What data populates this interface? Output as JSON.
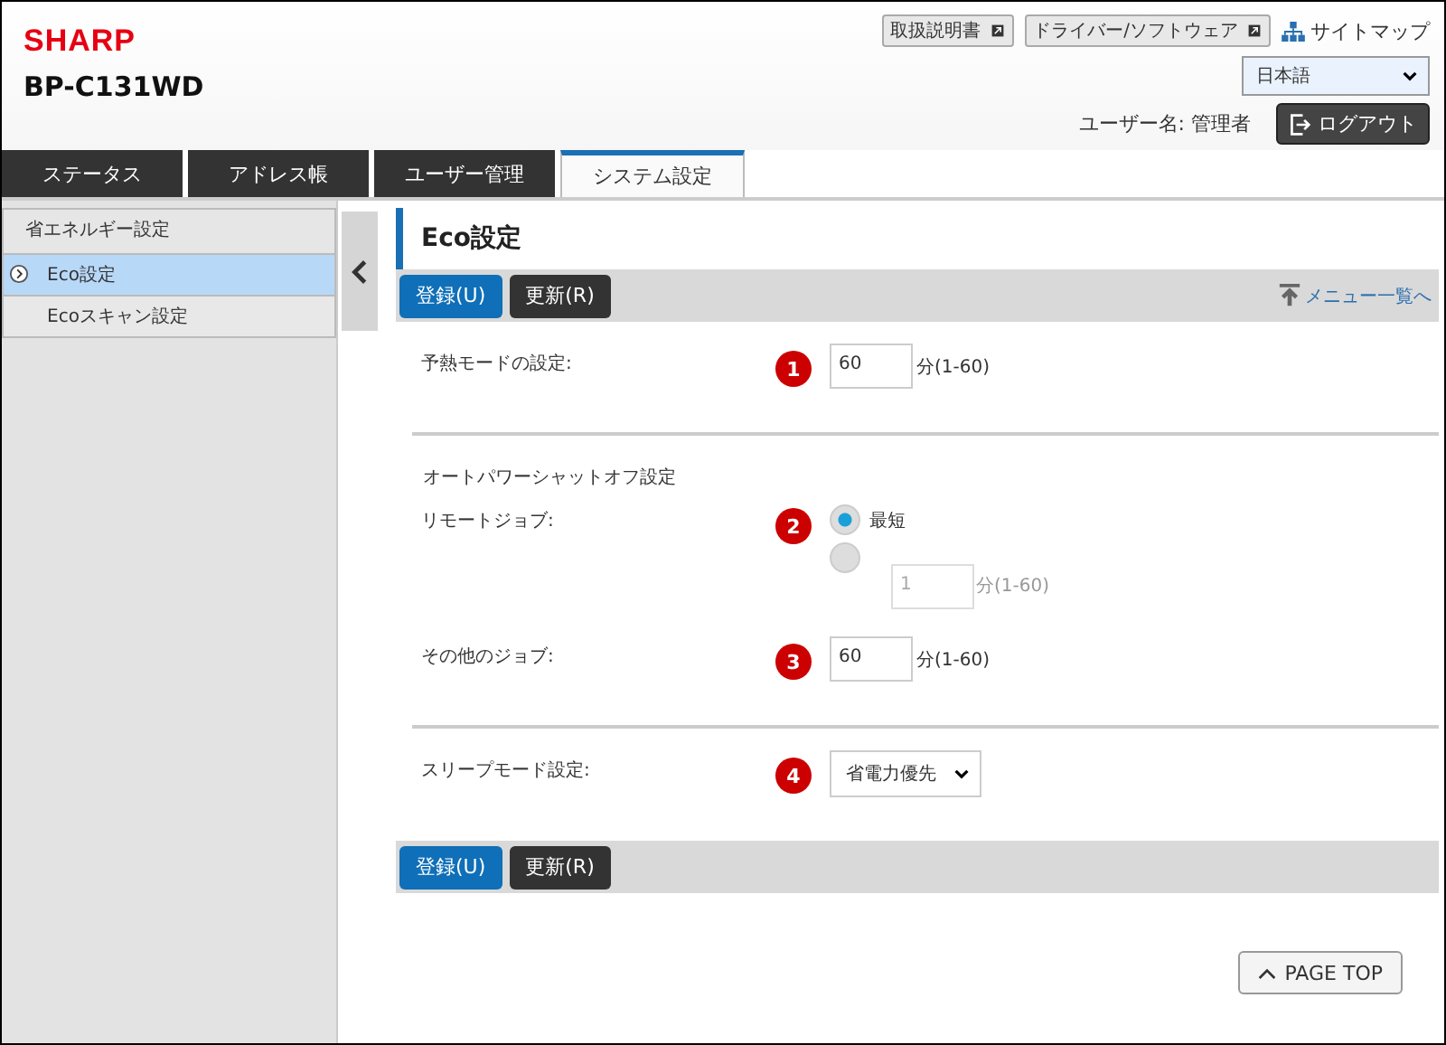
{
  "header": {
    "logo": "SHARP",
    "model": "BP-C131WD",
    "links": [
      {
        "label": "取扱説明書"
      },
      {
        "label": "ドライバー/ソフトウェア"
      }
    ],
    "sitemap": "サイトマップ",
    "language": "日本語",
    "user": "ユーザー名: 管理者",
    "logout": "ログアウト"
  },
  "tabs": [
    {
      "label": "ステータス",
      "selected": false
    },
    {
      "label": "アドレス帳",
      "selected": false
    },
    {
      "label": "ユーザー管理",
      "selected": false
    },
    {
      "label": "システム設定",
      "selected": true
    }
  ],
  "sidebar": {
    "title": "省エネルギー設定",
    "items": [
      {
        "label": "Eco設定",
        "selected": true
      },
      {
        "label": "Ecoスキャン設定",
        "selected": false
      }
    ]
  },
  "page": {
    "title": "Eco設定",
    "buttons": [
      {
        "label": "登録(U)",
        "kind": "primary"
      },
      {
        "label": "更新(R)",
        "kind": "dark"
      }
    ],
    "menu_link": "メニュー一覧へ",
    "sections": [
      {
        "rows": [
          {
            "label": "予熱モードの設定:",
            "badge": "1",
            "kind": "number",
            "value": "60",
            "unit": "分(1-60)"
          }
        ]
      },
      {
        "heading": "オートパワーシャットオフ設定",
        "rows": [
          {
            "label": "リモートジョブ:",
            "badge": "2",
            "kind": "radio",
            "options": [
              {
                "label": "最短",
                "selected": true
              },
              {
                "value": "1",
                "unit": "分(1-60)",
                "selected": false,
                "disabled": true
              }
            ]
          },
          {
            "label": "その他のジョブ:",
            "badge": "3",
            "kind": "number",
            "value": "60",
            "unit": "分(1-60)"
          }
        ]
      },
      {
        "rows": [
          {
            "label": "スリープモード設定:",
            "badge": "4",
            "kind": "select",
            "value": "省電力優先"
          }
        ]
      }
    ],
    "bottom_buttons": [
      {
        "label": "登録(U)",
        "kind": "primary"
      },
      {
        "label": "更新(R)",
        "kind": "dark"
      }
    ],
    "page_top": "PAGE TOP"
  }
}
